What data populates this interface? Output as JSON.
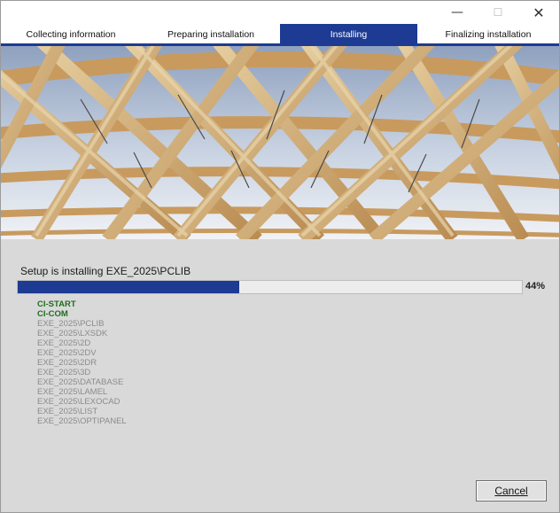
{
  "window": {
    "controls": {
      "minimize": "—",
      "maximize": "☐",
      "close": "✕"
    }
  },
  "steps": [
    {
      "label": "Collecting information",
      "active": false
    },
    {
      "label": "Preparing installation",
      "active": false
    },
    {
      "label": "Installing",
      "active": true
    },
    {
      "label": "Finalizing installation",
      "active": false
    }
  ],
  "banner": {
    "subject": "timber-lattice-roof-photo"
  },
  "progress": {
    "status_text": "Setup is installing EXE_2025\\PCLIB",
    "percent_label": "44%",
    "fraction": 0.44
  },
  "log": [
    {
      "text": "CI-START",
      "state": "done"
    },
    {
      "text": "CI-COM",
      "state": "done"
    },
    {
      "text": "EXE_2025\\PCLIB",
      "state": "pending"
    },
    {
      "text": "EXE_2025\\LXSDK",
      "state": "pending"
    },
    {
      "text": "EXE_2025\\2D",
      "state": "pending"
    },
    {
      "text": "EXE_2025\\2DV",
      "state": "pending"
    },
    {
      "text": "EXE_2025\\2DR",
      "state": "pending"
    },
    {
      "text": "EXE_2025\\3D",
      "state": "pending"
    },
    {
      "text": "EXE_2025\\DATABASE",
      "state": "pending"
    },
    {
      "text": "EXE_2025\\LAMEL",
      "state": "pending"
    },
    {
      "text": "EXE_2025\\LEXOCAD",
      "state": "pending"
    },
    {
      "text": "EXE_2025\\LIST",
      "state": "pending"
    },
    {
      "text": "EXE_2025\\OPTIPANEL",
      "state": "pending"
    }
  ],
  "buttons": {
    "cancel": "Cancel"
  },
  "colors": {
    "accent": "#1d3b92",
    "done": "#1f6e1f",
    "pending": "#8c8c8c",
    "panel": "#d9d9d9"
  }
}
